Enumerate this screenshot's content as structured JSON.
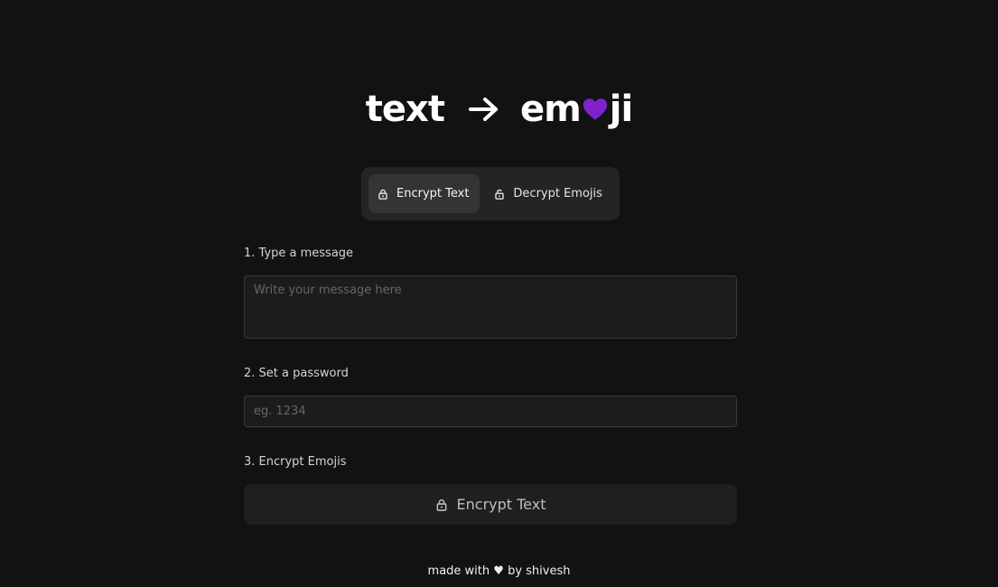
{
  "logo": {
    "left_word": "text",
    "right_prefix": "em",
    "right_suffix": "ji",
    "heart_color": "#7e22ce"
  },
  "tabs": [
    {
      "label": "Encrypt Text",
      "icon": "lock-icon",
      "active": true
    },
    {
      "label": "Decrypt Emojis",
      "icon": "unlock-icon",
      "active": false
    }
  ],
  "form": {
    "step1_label": "1. Type a message",
    "message_placeholder": "Write your message here",
    "message_value": "",
    "step2_label": "2. Set a password",
    "password_placeholder": "eg. 1234",
    "password_value": "",
    "step3_label": "3. Encrypt Emojis",
    "submit_label": "Encrypt Text"
  },
  "footer": {
    "prefix": "made with",
    "heart": "♥",
    "suffix": "by shivesh"
  },
  "colors": {
    "background": "#121212",
    "accent": "#7e22ce",
    "panel": "#242424"
  }
}
